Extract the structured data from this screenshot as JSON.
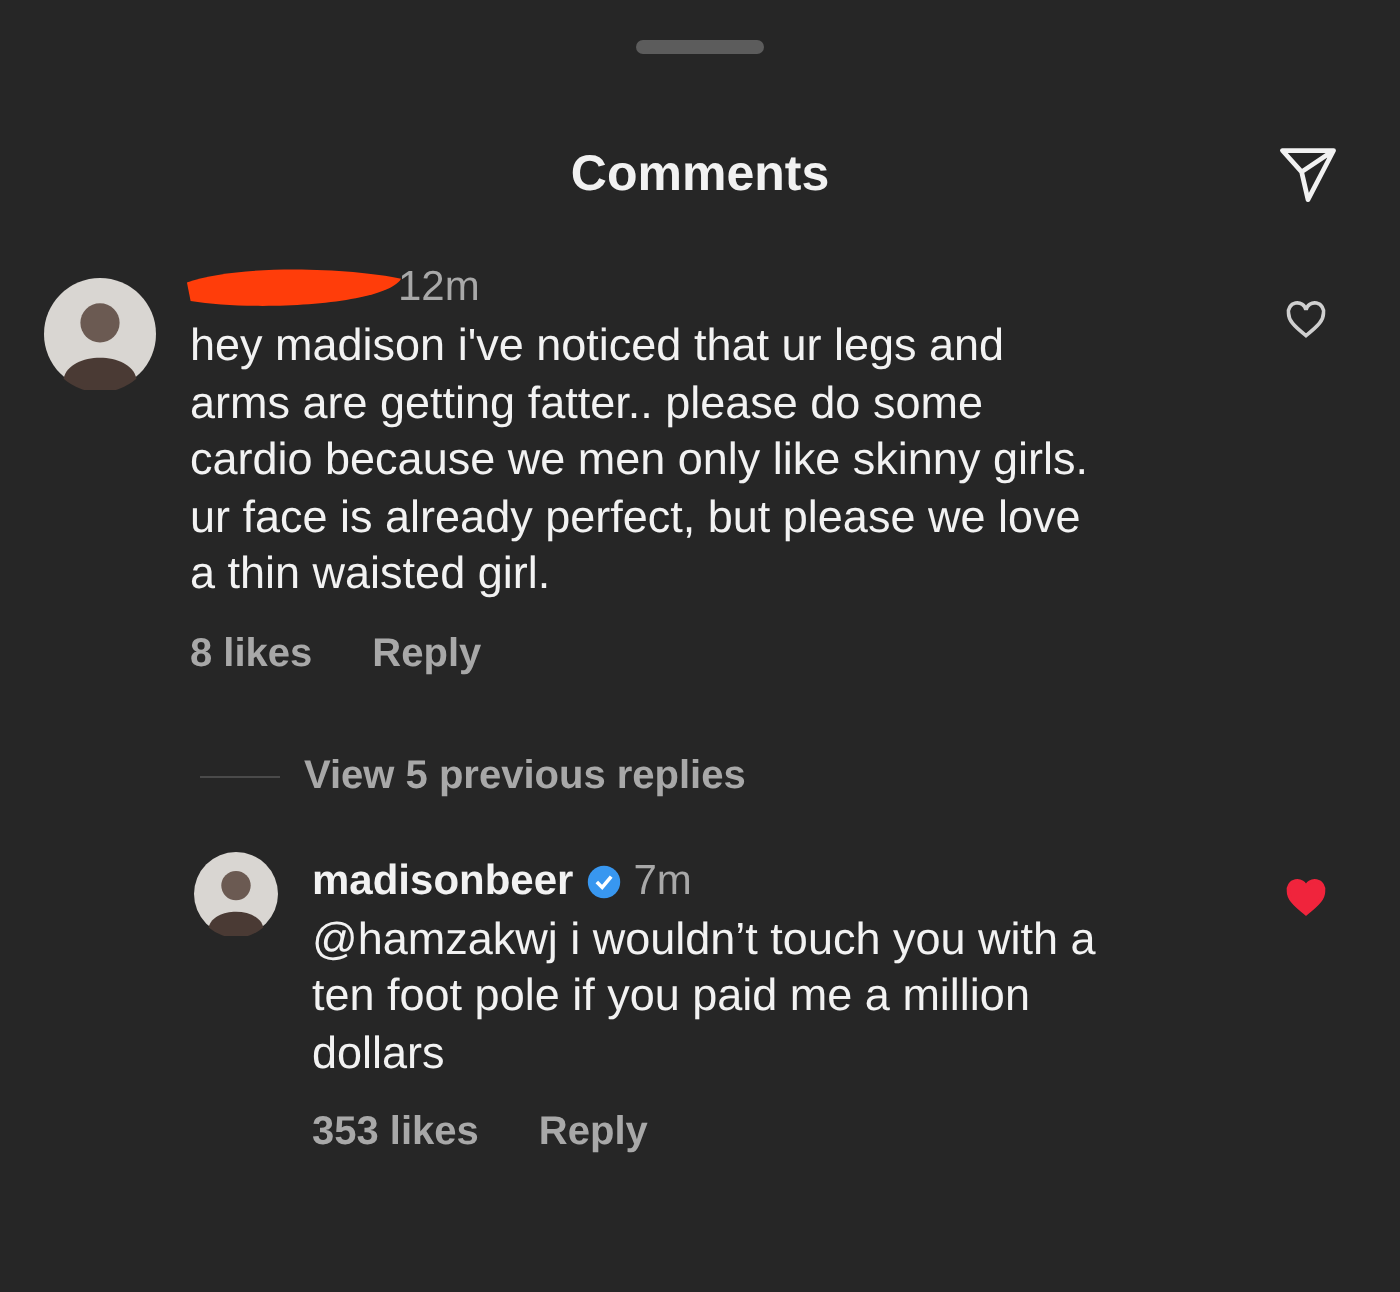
{
  "header": {
    "title": "Comments"
  },
  "comments": [
    {
      "username_redacted": true,
      "time": "12m",
      "text": "hey madison i've noticed that ur legs and arms are getting fatter.. please do some cardio because we men only like skinny girls. ur face is already perfect, but please we love a thin waisted girl.",
      "likes": "8 likes",
      "reply_label": "Reply",
      "liked": false,
      "view_replies": "View 5 previous replies",
      "children": [
        {
          "username": "madisonbeer",
          "verified": true,
          "time": "7m",
          "text": "@hamzakwj i wouldn’t touch you with a ten foot pole if you paid me a million dollars",
          "likes": "353 likes",
          "reply_label": "Reply",
          "liked": true
        }
      ]
    }
  ]
}
